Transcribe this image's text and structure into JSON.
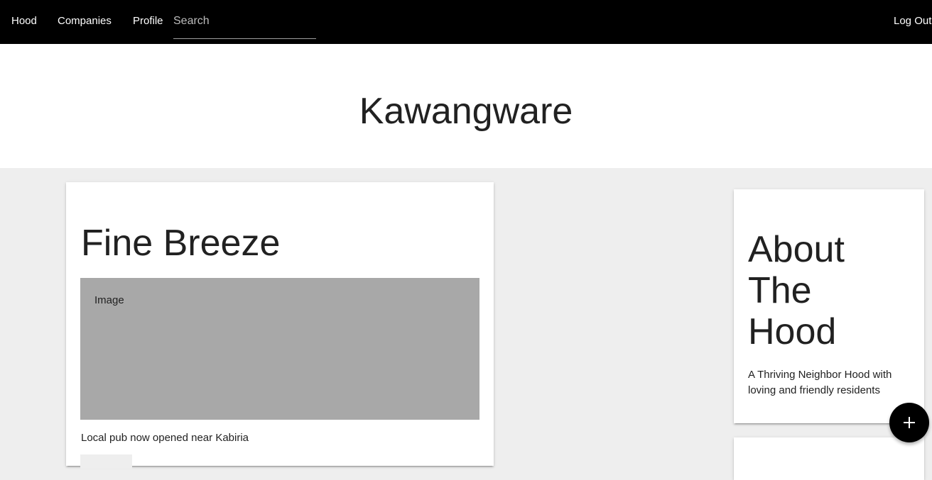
{
  "nav": {
    "links": [
      "Hood",
      "Companies",
      "Profile"
    ],
    "search_placeholder": "Search",
    "logout_label": "Log Out"
  },
  "hero": {
    "title": "Kawangware"
  },
  "post": {
    "title": "Fine Breeze",
    "image_label": "Image",
    "description": "Local pub now opened near Kabiria"
  },
  "about": {
    "title": "About The Hood",
    "description": "A Thriving Neighbor Hood with loving and friendly residents"
  },
  "fab": {
    "icon": "plus-icon"
  },
  "colors": {
    "navbar": "#000000",
    "page_background": "#eeeeee",
    "card": "#ffffff",
    "image_placeholder": "#a8a8a8",
    "fab": "#000000"
  }
}
